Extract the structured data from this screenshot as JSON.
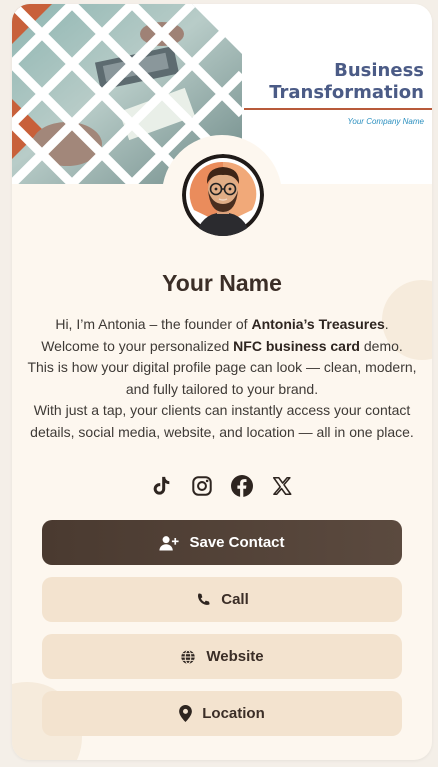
{
  "brand": {
    "line1": "Business",
    "line2": "Transformation",
    "tagline": "Your Company Name"
  },
  "colors": {
    "accent": "#b85a3a",
    "brand_text": "#4b5b86",
    "tagline": "#2a8fbf",
    "primary_button": "#4f3f35",
    "secondary_button": "#f3e3cf",
    "card_background": "#fdf7ef"
  },
  "profile": {
    "name": "Your Name",
    "bio": {
      "p1_a": "Hi, I’m Antonia – the founder of ",
      "p1_b": "Antonia’s Treasures",
      "p1_c": ".",
      "p2_a": "Welcome to your personalized ",
      "p2_b": "NFC business card",
      "p2_c": " demo.",
      "p3": "This is how your digital profile page can look — clean, modern, and fully tailored to your brand.",
      "p4": "With just a tap, your clients can instantly access your contact details, social media, website, and location — all in one place."
    }
  },
  "socials": [
    {
      "icon": "tiktok-icon"
    },
    {
      "icon": "instagram-icon"
    },
    {
      "icon": "facebook-icon"
    },
    {
      "icon": "x-icon"
    }
  ],
  "buttons": {
    "save": {
      "label": "Save Contact",
      "icon": "user-plus-icon"
    },
    "call": {
      "label": "Call",
      "icon": "phone-icon"
    },
    "website": {
      "label": "Website",
      "icon": "globe-icon"
    },
    "location": {
      "label": "Location",
      "icon": "map-pin-icon"
    }
  }
}
